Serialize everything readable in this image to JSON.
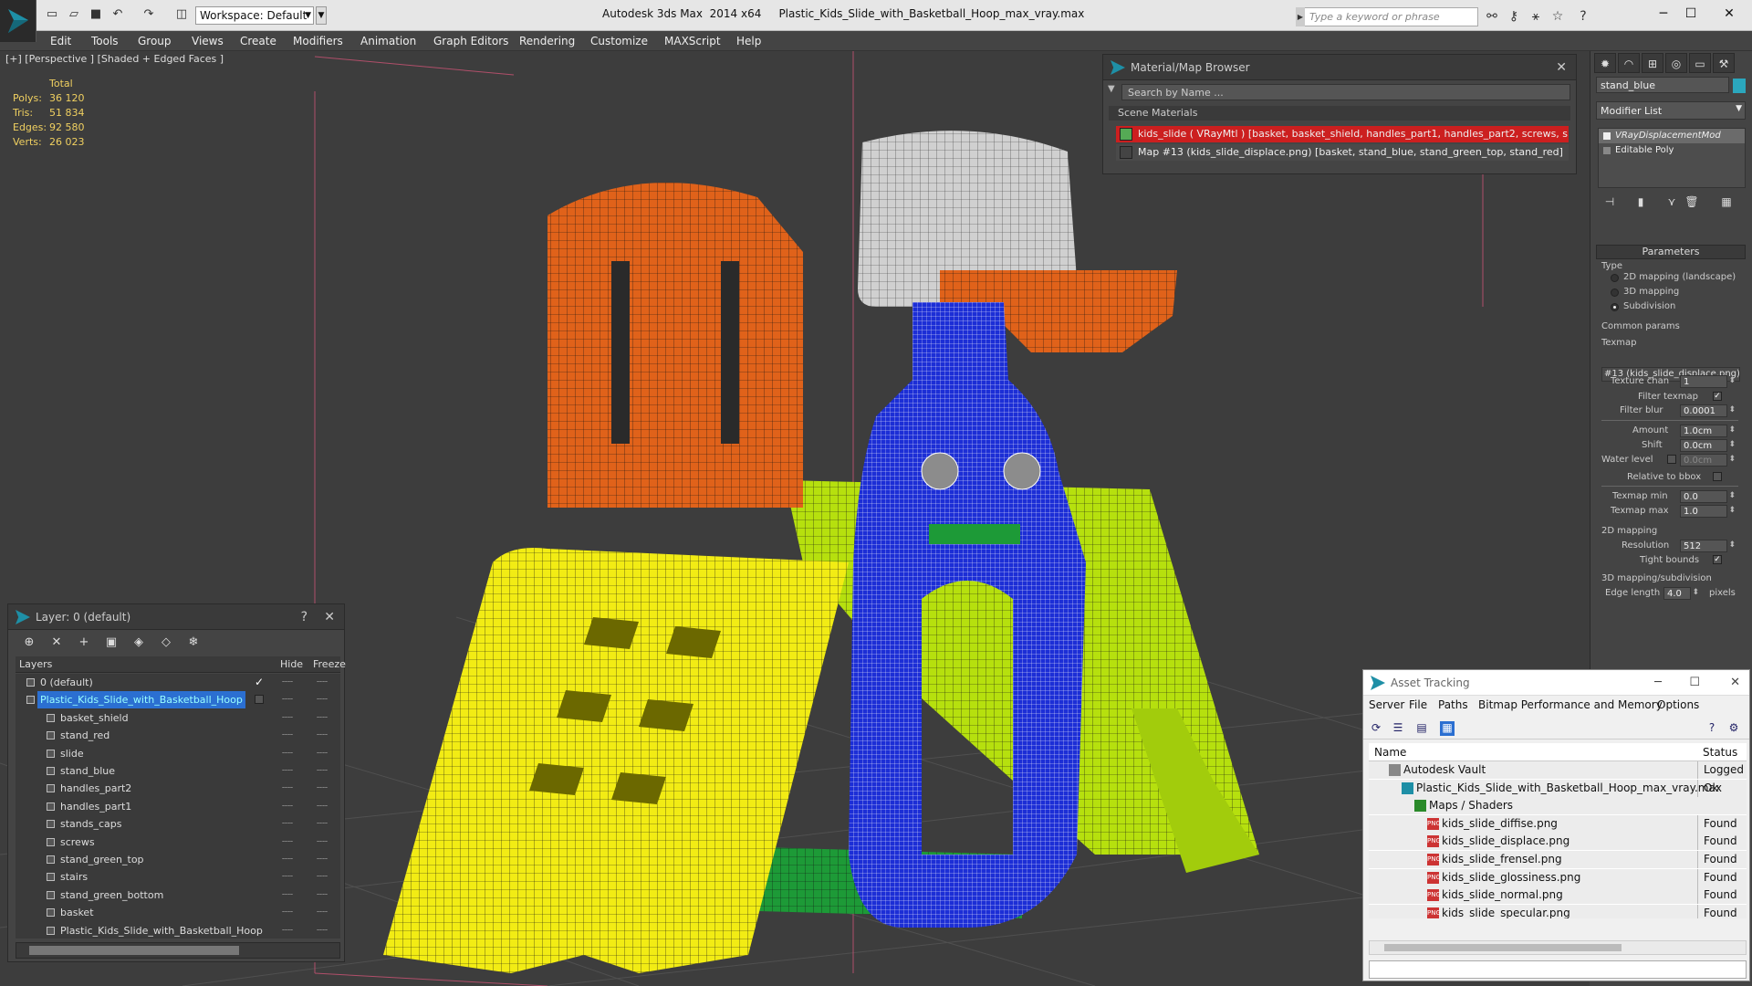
{
  "title_bar": {
    "app_title": "Autodesk 3ds Max  2014 x64",
    "file_name": "Plastic_Kids_Slide_with_Basketball_Hoop_max_vray.max",
    "workspace": "Workspace: Default",
    "search_placeholder": "Type a keyword or phrase"
  },
  "menu": [
    "Edit",
    "Tools",
    "Group",
    "Views",
    "Create",
    "Modifiers",
    "Animation",
    "Graph Editors",
    "Rendering",
    "Customize",
    "MAXScript",
    "Help"
  ],
  "viewport": {
    "label": "[+] [Perspective ] [Shaded + Edged Faces ]",
    "stats": {
      "header": "Total",
      "rows": [
        {
          "k": "Polys:",
          "v": "36 120"
        },
        {
          "k": "Tris:",
          "v": "51 834"
        },
        {
          "k": "Edges:",
          "v": "92 580"
        },
        {
          "k": "Verts:",
          "v": "26 023"
        }
      ]
    }
  },
  "material_browser": {
    "title": "Material/Map Browser",
    "search_placeholder": "Search by Name ...",
    "section": "Scene Materials",
    "rows": [
      "kids_slide ( VRayMtl ) [basket, basket_shield, handles_part1, handles_part2, screws, slid...",
      "Map #13 (kids_slide_displace.png) [basket, stand_blue, stand_green_top, stand_red]"
    ]
  },
  "command_panel": {
    "object_name": "stand_blue",
    "object_color": "#2ba7bd",
    "modifier_list": "Modifier List",
    "stack": [
      "VRayDisplacementMod",
      "Editable Poly"
    ],
    "parameters": "Parameters",
    "type_label": "Type",
    "type_options": [
      "2D mapping (landscape)",
      "3D mapping",
      "Subdivision"
    ],
    "selected_type": "Subdivision",
    "common_params": "Common params",
    "texmap_label": "Texmap",
    "texmap_value": "#13 (kids_slide_displace.png)",
    "texture_chan_label": "Texture chan",
    "texture_chan": "1",
    "filter_texmap_label": "Filter texmap",
    "filter_blur_label": "Filter blur",
    "filter_blur": "0.0001",
    "amount_label": "Amount",
    "amount": "1.0cm",
    "shift_label": "Shift",
    "shift": "0.0cm",
    "water_level_label": "Water level",
    "water_level": "0.0cm",
    "relative_bbox_label": "Relative to bbox",
    "texmap_min_label": "Texmap min",
    "texmap_min": "0.0",
    "texmap_max_label": "Texmap max",
    "texmap_max": "1.0",
    "mapping2d_label": "2D mapping",
    "resolution_label": "Resolution",
    "resolution": "512",
    "tight_bounds_label": "Tight bounds",
    "mapping3d_label": "3D mapping/subdivision",
    "edge_length_label": "Edge length",
    "edge_length": "4.0",
    "pixels_label": "pixels"
  },
  "layers": {
    "title": "Layer: 0 (default)",
    "header": {
      "name": "Layers",
      "hide": "Hide",
      "freeze": "Freeze"
    },
    "rows": [
      {
        "name": "0 (default)",
        "level": 0,
        "selected": false,
        "current": true
      },
      {
        "name": "Plastic_Kids_Slide_with_Basketball_Hoop",
        "level": 0,
        "selected": true,
        "current": false
      },
      {
        "name": "basket_shield",
        "level": 1
      },
      {
        "name": "stand_red",
        "level": 1
      },
      {
        "name": "slide",
        "level": 1
      },
      {
        "name": "stand_blue",
        "level": 1
      },
      {
        "name": "handles_part2",
        "level": 1
      },
      {
        "name": "handles_part1",
        "level": 1
      },
      {
        "name": "stands_caps",
        "level": 1
      },
      {
        "name": "screws",
        "level": 1
      },
      {
        "name": "stand_green_top",
        "level": 1
      },
      {
        "name": "stairs",
        "level": 1
      },
      {
        "name": "stand_green_bottom",
        "level": 1
      },
      {
        "name": "basket",
        "level": 1
      },
      {
        "name": "Plastic_Kids_Slide_with_Basketball_Hoop",
        "level": 1
      }
    ]
  },
  "asset_tracking": {
    "title": "Asset Tracking",
    "menu": [
      "Server",
      "File",
      "Paths",
      "Bitmap Performance and Memory",
      "Options"
    ],
    "header": {
      "name": "Name",
      "status": "Status"
    },
    "rows": [
      {
        "name": "Autodesk Vault",
        "status": "Logged Out",
        "level": 0,
        "icon": "vault"
      },
      {
        "name": "Plastic_Kids_Slide_with_Basketball_Hoop_max_vray.max",
        "status": "Ok",
        "level": 1,
        "icon": "max"
      },
      {
        "name": "Maps / Shaders",
        "status": "",
        "level": 2,
        "icon": "folder"
      },
      {
        "name": "kids_slide_diffise.png",
        "status": "Found",
        "level": 3,
        "icon": "png"
      },
      {
        "name": "kids_slide_displace.png",
        "status": "Found",
        "level": 3,
        "icon": "png"
      },
      {
        "name": "kids_slide_frensel.png",
        "status": "Found",
        "level": 3,
        "icon": "png"
      },
      {
        "name": "kids_slide_glossiness.png",
        "status": "Found",
        "level": 3,
        "icon": "png"
      },
      {
        "name": "kids_slide_normal.png",
        "status": "Found",
        "level": 3,
        "icon": "png"
      },
      {
        "name": "kids_slide_specular.png",
        "status": "Found",
        "level": 3,
        "icon": "png"
      }
    ]
  },
  "scene_colors": {
    "stand_red": "#e0621a",
    "stairs": "#f2ec14",
    "stand_blue": "#1c2ed6",
    "slide": "#b6e00e",
    "basket_shield": "#d0d0d0",
    "stand_green": "#1d9a37",
    "wire": "#111111"
  }
}
